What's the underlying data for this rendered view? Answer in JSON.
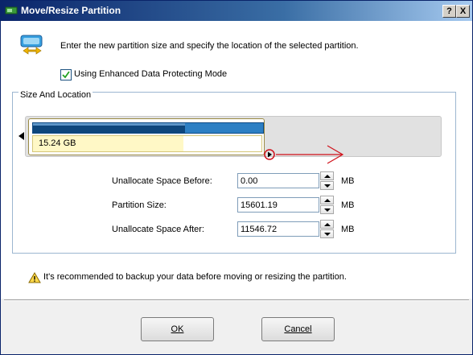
{
  "window": {
    "title": "Move/Resize Partition",
    "help_label": "?",
    "close_label": "X"
  },
  "header": {
    "instruction": "Enter the new partition size and specify the location of the selected partition."
  },
  "options": {
    "protect_mode_label": "Using Enhanced Data Protecting Mode",
    "protect_mode_checked": true
  },
  "group": {
    "title": "Size And Location",
    "partition_label": "15.24 GB",
    "used_fraction": 0.66,
    "fields": [
      {
        "label": "Unallocate Space Before:",
        "value": "0.00",
        "unit": "MB"
      },
      {
        "label": "Partition Size:",
        "value": "15601.19",
        "unit": "MB"
      },
      {
        "label": "Unallocate Space After:",
        "value": "11546.72",
        "unit": "MB"
      }
    ]
  },
  "warning": {
    "text": "It's recommended to backup your data before moving or resizing the partition."
  },
  "buttons": {
    "ok_label": "OK",
    "cancel_label": "Cancel"
  },
  "colors": {
    "titlebar": "#0a246a",
    "partition_fill": "#0d467c",
    "partition_free": "#2c7fc4",
    "arrow": "#d0101a",
    "yellow": "#fff8c6"
  }
}
